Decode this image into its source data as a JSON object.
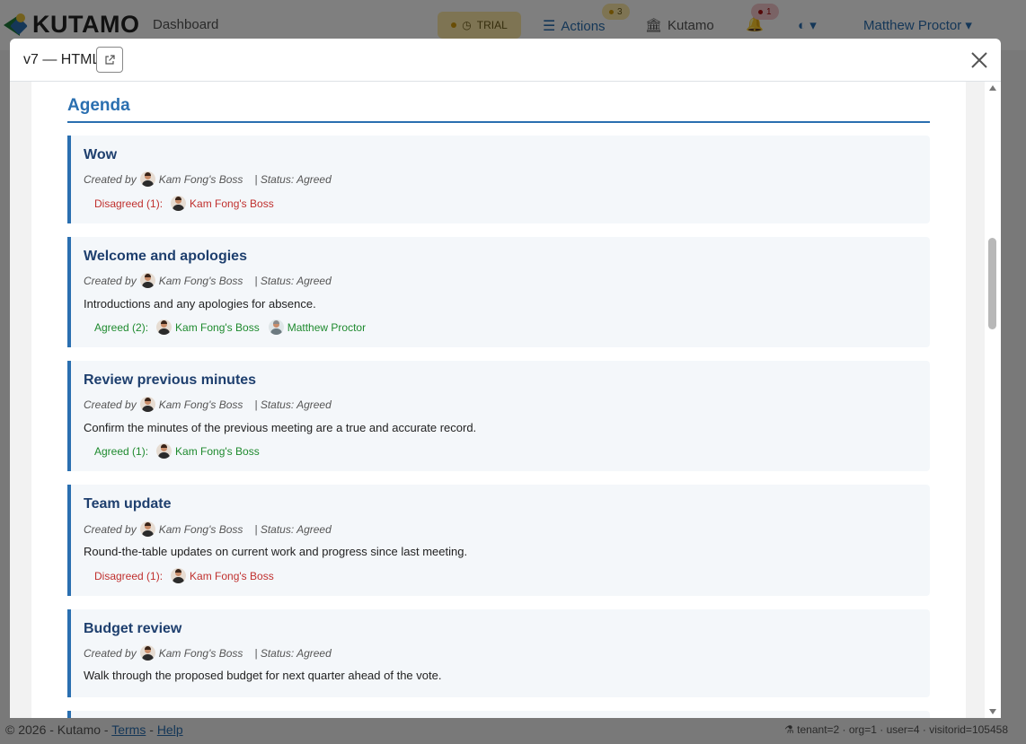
{
  "app": {
    "brand": "KUTAMO",
    "nav_dashboard": "Dashboard",
    "trial_label": "TRIAL",
    "actions_label": "Actions",
    "actions_badge": "3",
    "kutamo_label": "Kutamo",
    "bell_badge": "1",
    "user_name": "Matthew Proctor"
  },
  "footer": {
    "copyright": "© 2026 - Kutamo -",
    "terms": "Terms",
    "separator": "-",
    "help": "Help",
    "debug": "tenant=2 · org=1 · user=4 · visitorid=105458"
  },
  "modal": {
    "title": "v7 — HTML"
  },
  "agenda": {
    "heading": "Agenda",
    "created_by_label": "Created by",
    "items": [
      {
        "title": "Wow",
        "creator": "Kam Fong's Boss",
        "status": "| Status: Agreed",
        "description": "",
        "vote_label": "Disagreed (1):",
        "voters": [
          "Kam Fong's Boss"
        ]
      },
      {
        "title": "Welcome and apologies",
        "creator": "Kam Fong's Boss",
        "status": "| Status: Agreed",
        "description": "Introductions and any apologies for absence.",
        "vote_label": "Agreed (2):",
        "voters": [
          "Kam Fong's Boss",
          "Matthew Proctor"
        ]
      },
      {
        "title": "Review previous minutes",
        "creator": "Kam Fong's Boss",
        "status": "| Status: Agreed",
        "description": "Confirm the minutes of the previous meeting are a true and accurate record.",
        "vote_label": "Agreed (1):",
        "voters": [
          "Kam Fong's Boss"
        ]
      },
      {
        "title": "Team update",
        "creator": "Kam Fong's Boss",
        "status": "| Status: Agreed",
        "description": "Round-the-table updates on current work and progress since last meeting.",
        "vote_label": "Disagreed (1):",
        "voters": [
          "Kam Fong's Boss"
        ]
      },
      {
        "title": "Budget review",
        "creator": "Kam Fong's Boss",
        "status": "| Status: Agreed",
        "description": "Walk through the proposed budget for next quarter ahead of the vote.",
        "vote_label": "",
        "voters": []
      }
    ]
  },
  "colors": {
    "accent": "#2a6fb0",
    "agreed": "#1e8a2e",
    "disagreed": "#c0302e"
  }
}
